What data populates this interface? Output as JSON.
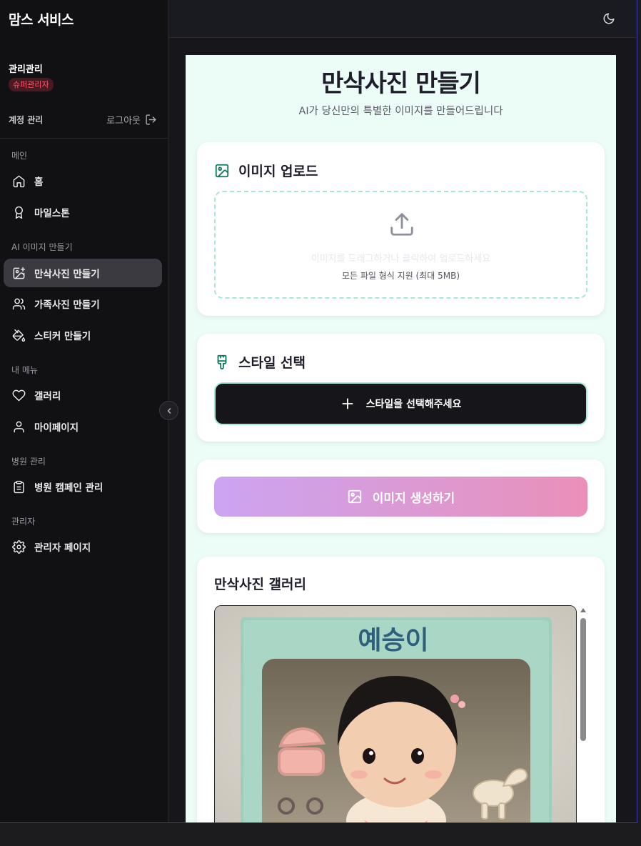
{
  "app": {
    "title": "맘스 서비스"
  },
  "user": {
    "name": "관리관리",
    "role": "슈퍼관리자"
  },
  "account": {
    "label": "계정 관리",
    "logout": "로그아웃"
  },
  "sidebar": {
    "sections": [
      {
        "title": "메인"
      },
      {
        "title": "AI 이미지 만들기"
      },
      {
        "title": "내 메뉴"
      },
      {
        "title": "병원 관리"
      },
      {
        "title": "관리자"
      }
    ],
    "items": [
      {
        "label": "홈",
        "icon": "home-icon"
      },
      {
        "label": "마일스톤",
        "icon": "award-icon"
      },
      {
        "label": "만삭사진 만들기",
        "icon": "image-plus-icon",
        "active": true
      },
      {
        "label": "가족사진 만들기",
        "icon": "users-icon"
      },
      {
        "label": "스티커 만들기",
        "icon": "paint-bucket-icon"
      },
      {
        "label": "갤러리",
        "icon": "heart-icon"
      },
      {
        "label": "마이페이지",
        "icon": "user-icon"
      },
      {
        "label": "병원 캠페인 관리",
        "icon": "clipboard-icon"
      },
      {
        "label": "관리자 페이지",
        "icon": "gear-icon"
      }
    ]
  },
  "header": {
    "theme_icon": "moon-icon"
  },
  "main": {
    "title": "만삭사진 만들기",
    "subtitle": "AI가 당신만의 특별한 이미지를 만들어드립니다",
    "upload": {
      "title": "이미지 업로드",
      "primary": "이미지를 드래그하거나 클릭하여 업로드하세요",
      "secondary": "모든 파일 형식 지원 (최대 5MB)"
    },
    "style": {
      "title": "스타일 선택",
      "button": "스타일을 선택해주세요"
    },
    "generate": {
      "button": "이미지 생성하기"
    },
    "gallery": {
      "title": "만삭사진 갤러리",
      "image_text": "예승이"
    }
  },
  "colors": {
    "accent": "#0f7a5a",
    "badge": "#ff5b6e",
    "gradient_start": "#cba4f2",
    "gradient_end": "#ea90b8",
    "main_bg": "#ecfdf7"
  }
}
